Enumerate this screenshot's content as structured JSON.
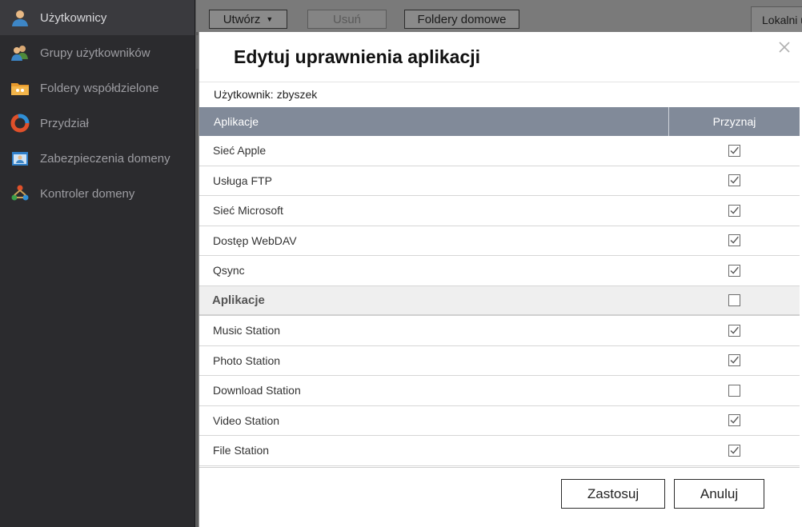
{
  "sidebar": {
    "items": [
      {
        "label": "Użytkownicy",
        "icon": "user-icon",
        "active": true
      },
      {
        "label": "Grupy użytkowników",
        "icon": "user-group-icon"
      },
      {
        "label": "Foldery współdzielone",
        "icon": "shared-folder-icon"
      },
      {
        "label": "Przydział",
        "icon": "quota-icon"
      },
      {
        "label": "Zabezpieczenia domeny",
        "icon": "domain-security-icon"
      },
      {
        "label": "Kontroler domeny",
        "icon": "domain-controller-icon"
      }
    ]
  },
  "toolbar": {
    "create_label": "Utwórz",
    "delete_label": "Usuń",
    "home_folders_label": "Foldery domowe",
    "local_panel_label": "Lokalni u"
  },
  "dialog": {
    "title": "Edytuj uprawnienia aplikacji",
    "user_label": "Użytkownik:",
    "user_value": "zbyszek",
    "columns": {
      "app": "Aplikacje",
      "grant": "Przyznaj"
    },
    "rows": [
      {
        "label": "Sieć Apple",
        "checked": true
      },
      {
        "label": "Usługa FTP",
        "checked": true
      },
      {
        "label": "Sieć Microsoft",
        "checked": true
      },
      {
        "label": "Dostęp WebDAV",
        "checked": true
      },
      {
        "label": "Qsync",
        "checked": true
      }
    ],
    "group_label": "Aplikacje",
    "group_checked": false,
    "app_rows": [
      {
        "label": "Music Station",
        "checked": true
      },
      {
        "label": "Photo Station",
        "checked": true
      },
      {
        "label": "Download Station",
        "checked": false
      },
      {
        "label": "Video Station",
        "checked": true
      },
      {
        "label": "File Station",
        "checked": true
      }
    ],
    "apply_label": "Zastosuj",
    "cancel_label": "Anuluj"
  }
}
